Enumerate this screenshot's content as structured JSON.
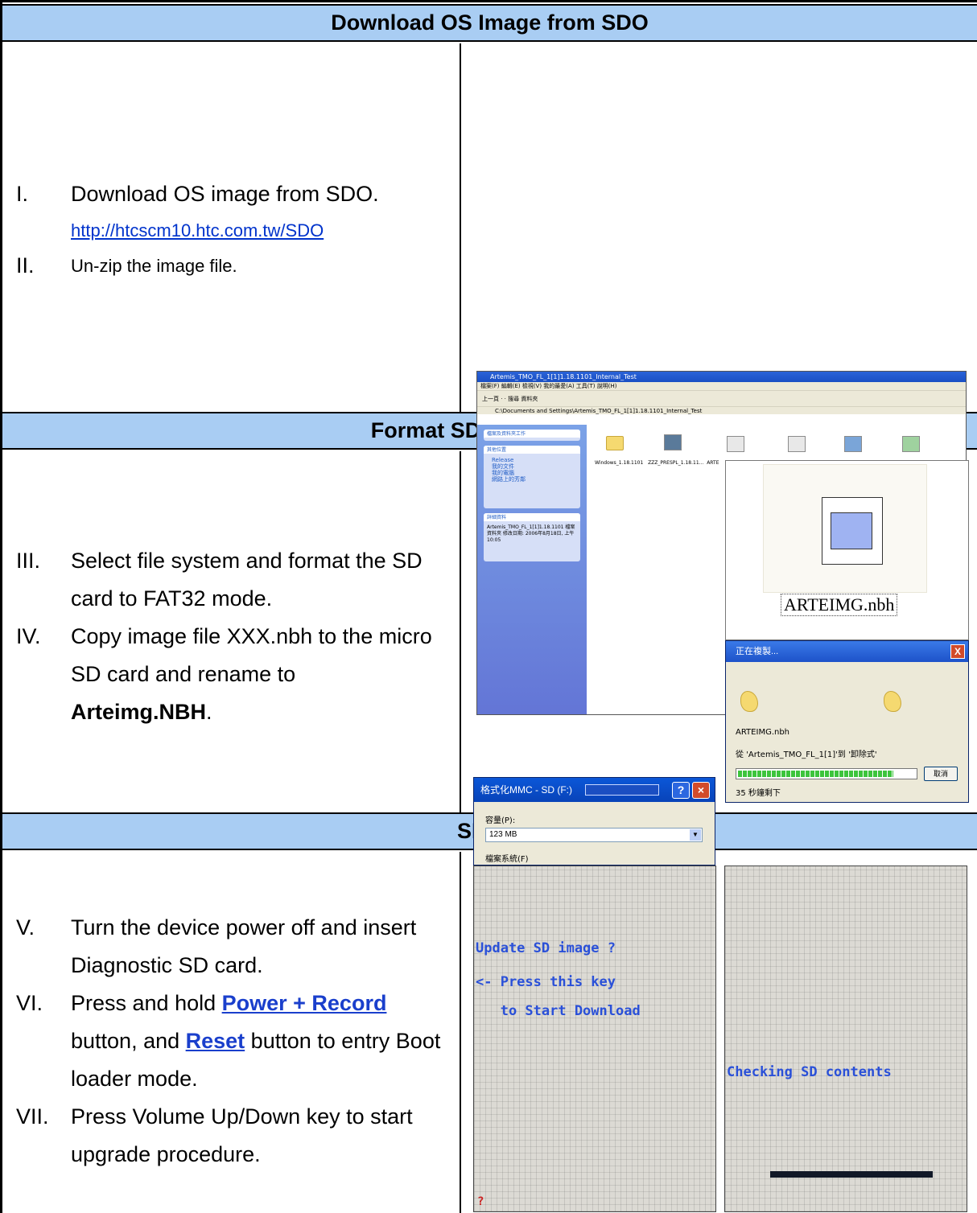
{
  "sections": {
    "download": {
      "header": "Download OS Image from SDO",
      "steps": [
        {
          "num": "I.",
          "text": "Download OS image from SDO.",
          "link": "http://htcscm10.htc.com.tw/SDO"
        },
        {
          "num": "II.",
          "text": "Un-zip the image file."
        }
      ]
    },
    "format": {
      "header": "Format SD card and co",
      "steps": [
        {
          "num": "III.",
          "text": "Select file system and format the SD card to FAT32 mode."
        },
        {
          "num": "IV.",
          "text_a": "Copy image file XXX.nbh to the micro SD card and rename to",
          "bold": "Arteimg.NBH",
          "tail": "."
        }
      ]
    },
    "update": {
      "header": "SD Up",
      "steps": [
        {
          "num": "V.",
          "text": "Turn the device power off and insert Diagnostic SD card."
        },
        {
          "num": "VI.",
          "pre": "Press and hold ",
          "key1": "Power + Record",
          "mid": " button, and ",
          "key2": "Reset",
          "post": " button to entry Boot loader mode."
        },
        {
          "num": "VII.",
          "text": "Press Volume Up/Down key to start upgrade procedure."
        }
      ]
    }
  },
  "explorer": {
    "title": "Artemis_TMO_FL_1[1]1.18.1101_Internal_Test",
    "menu": "檔案(F)  編輯(E)  檢視(V)  我的最愛(A)  工具(T)  說明(H)",
    "toolbar": "上一頁 ·  ·  搜尋  資料夾",
    "address": "C:\\Documents and Settings\\Artemis_TMO_FL_1[1]1.18.1101_Internal_Test",
    "panel1_title": "檔案及資料夾工作",
    "panel2_title": "其他位置",
    "panel2_items": [
      "Release",
      "我的文件",
      "我的電腦",
      "網路上的芳鄰"
    ],
    "panel3_title": "詳細資料",
    "panel3_text": "Artemis_TMO_FL_1[1]1.18.1101 檔案資料夾 修改日期: 2006年8月18日, 上午10:05",
    "file_labels": [
      "Windows_1.18.1101",
      "ZZZ_PRESPL_1.18.11...",
      "ARTE"
    ]
  },
  "preview": {
    "filename": "ARTEIMG.nbh"
  },
  "copy_dialog": {
    "title": "正在複製...",
    "file": "ARTEIMG.nbh",
    "from": "從 'Artemis_TMO_FL_1[1]'到 '卸除式'",
    "remaining": "35 秒鐘剩下",
    "cancel": "取消",
    "progress_pct": 88
  },
  "format_dialog": {
    "title": "格式化MMC - SD (F:)",
    "capacity_label": "容量(P):",
    "capacity_value": "123 MB",
    "fs_label": "檔案系統(F)"
  },
  "phone1": {
    "lines": [
      "Update SD image ?",
      "<- Press this key",
      "   to Start Download"
    ],
    "corner": "?"
  },
  "phone2": {
    "lines": [
      "Checking SD contents"
    ]
  },
  "colors": {
    "header_bg": "#a9cdf3",
    "link": "#0033cc"
  }
}
